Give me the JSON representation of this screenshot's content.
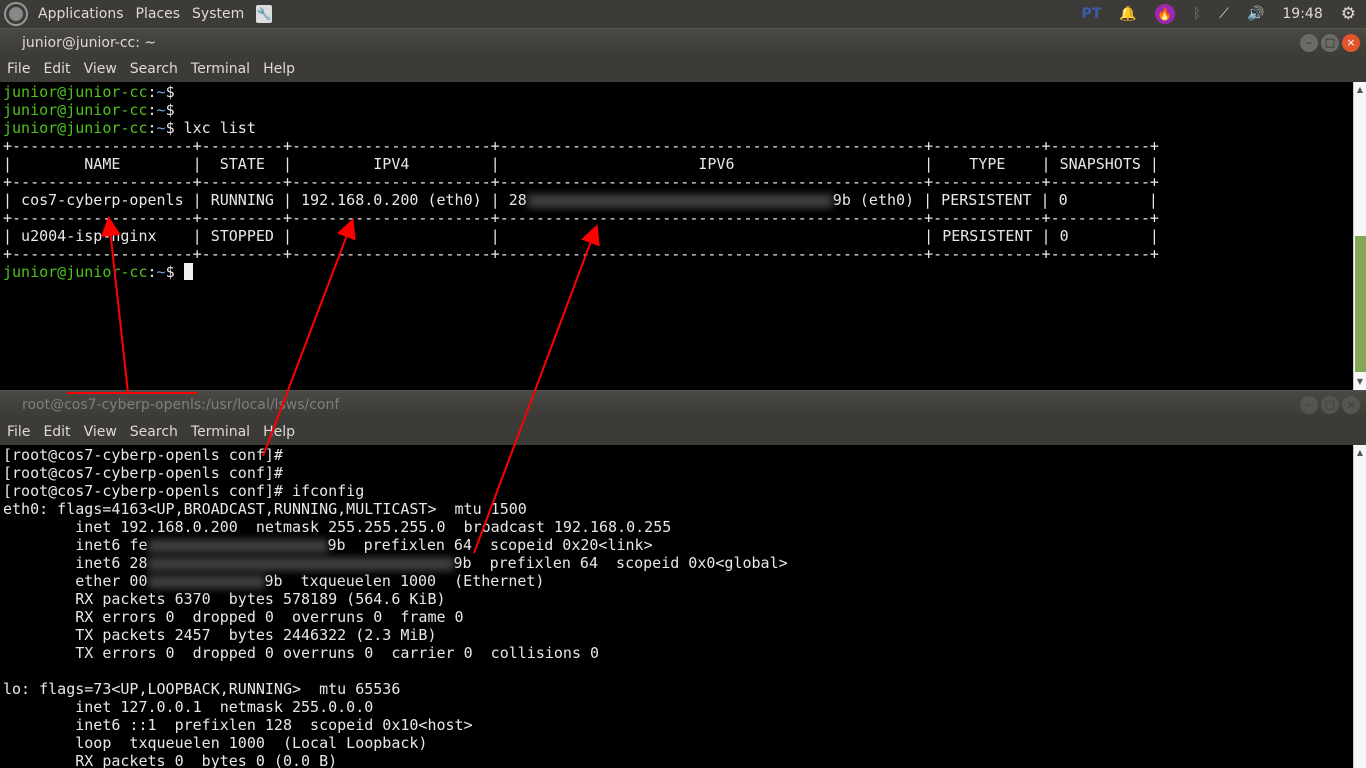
{
  "panel": {
    "menus": [
      "Applications",
      "Places",
      "System"
    ],
    "indicators": {
      "keyboard": "PT",
      "clock": "19:48"
    },
    "icons": [
      "ubuntu-logo-icon",
      "tools-icon",
      "keyboard-layout-icon",
      "bell-icon",
      "firefox-icon",
      "bluetooth-icon",
      "network-icon",
      "volume-icon",
      "gear-icon"
    ]
  },
  "menu_labels": [
    "File",
    "Edit",
    "View",
    "Search",
    "Terminal",
    "Help"
  ],
  "window1": {
    "title": "junior@junior-cc: ~",
    "lines": [
      [
        {
          "t": "junior@junior-cc",
          "c": "g"
        },
        {
          "t": ":"
        },
        {
          "t": "~",
          "c": "b"
        },
        {
          "t": "$"
        }
      ],
      [
        {
          "t": "junior@junior-cc",
          "c": "g"
        },
        {
          "t": ":"
        },
        {
          "t": "~",
          "c": "b"
        },
        {
          "t": "$"
        }
      ],
      [
        {
          "t": "junior@junior-cc",
          "c": "g"
        },
        {
          "t": ":"
        },
        {
          "t": "~",
          "c": "b"
        },
        {
          "t": "$ lxc list"
        }
      ],
      [
        {
          "t": "+--------------------+---------+----------------------+-----------------------------------------------+------------+-----------+"
        }
      ],
      [
        {
          "t": "|        NAME        |  STATE  |         IPV4         |                      IPV6                     |    TYPE    | SNAPSHOTS |"
        }
      ],
      [
        {
          "t": "+--------------------+---------+----------------------+-----------------------------------------------+------------+-----------+"
        }
      ],
      [
        {
          "t": "| cos7-cyberp-openls | RUNNING | 192.168.0.200 (eth0) | 28"
        },
        {
          "blur": 34
        },
        {
          "t": "9b (eth0) | PERSISTENT | 0         |"
        }
      ],
      [
        {
          "t": "+--------------------+---------+----------------------+-----------------------------------------------+------------+-----------+"
        }
      ],
      [
        {
          "t": "| u2004-isp-nginx    | STOPPED |                      |                                               | PERSISTENT | 0         |"
        }
      ],
      [
        {
          "t": "+--------------------+---------+----------------------+-----------------------------------------------+------------+-----------+"
        }
      ],
      [
        {
          "t": "junior@junior-cc",
          "c": "g"
        },
        {
          "t": ":"
        },
        {
          "t": "~",
          "c": "b"
        },
        {
          "t": "$ "
        },
        {
          "cursor": true
        }
      ]
    ],
    "scroll_position": 1.0
  },
  "window2": {
    "title": "root@cos7-cyberp-openls:/usr/local/lsws/conf",
    "lines": [
      [
        {
          "t": "[root@cos7-cyberp-openls conf]#"
        }
      ],
      [
        {
          "t": "[root@cos7-cyberp-openls conf]#"
        }
      ],
      [
        {
          "t": "[root@cos7-cyberp-openls conf]# ifconfig"
        }
      ],
      [
        {
          "t": "eth0: flags=4163<UP,BROADCAST,RUNNING,MULTICAST>  mtu 1500"
        }
      ],
      [
        {
          "t": "        inet 192.168.0.200  netmask 255.255.255.0  broadcast 192.168.0.255"
        }
      ],
      [
        {
          "t": "        inet6 fe"
        },
        {
          "blur": 20
        },
        {
          "t": "9b  prefixlen 64  scopeid 0x20<link>"
        }
      ],
      [
        {
          "t": "        inet6 28"
        },
        {
          "blur": 34
        },
        {
          "t": "9b  prefixlen 64  scopeid 0x0<global>"
        }
      ],
      [
        {
          "t": "        ether 00"
        },
        {
          "blur": 13
        },
        {
          "t": "9b  txqueuelen 1000  (Ethernet)"
        }
      ],
      [
        {
          "t": "        RX packets 6370  bytes 578189 (564.6 KiB)"
        }
      ],
      [
        {
          "t": "        RX errors 0  dropped 0  overruns 0  frame 0"
        }
      ],
      [
        {
          "t": "        TX packets 2457  bytes 2446322 (2.3 MiB)"
        }
      ],
      [
        {
          "t": "        TX errors 0  dropped 0 overruns 0  carrier 0  collisions 0"
        }
      ],
      [
        {
          "t": ""
        }
      ],
      [
        {
          "t": "lo: flags=73<UP,LOOPBACK,RUNNING>  mtu 65536"
        }
      ],
      [
        {
          "t": "        inet 127.0.0.1  netmask 255.0.0.0"
        }
      ],
      [
        {
          "t": "        inet6 ::1  prefixlen 128  scopeid 0x10<host>"
        }
      ],
      [
        {
          "t": "        loop  txqueuelen 1000  (Local Loopback)"
        }
      ],
      [
        {
          "t": "        RX packets 0  bytes 0 (0.0 B)"
        }
      ]
    ]
  },
  "annotation_color": "#ff0000"
}
